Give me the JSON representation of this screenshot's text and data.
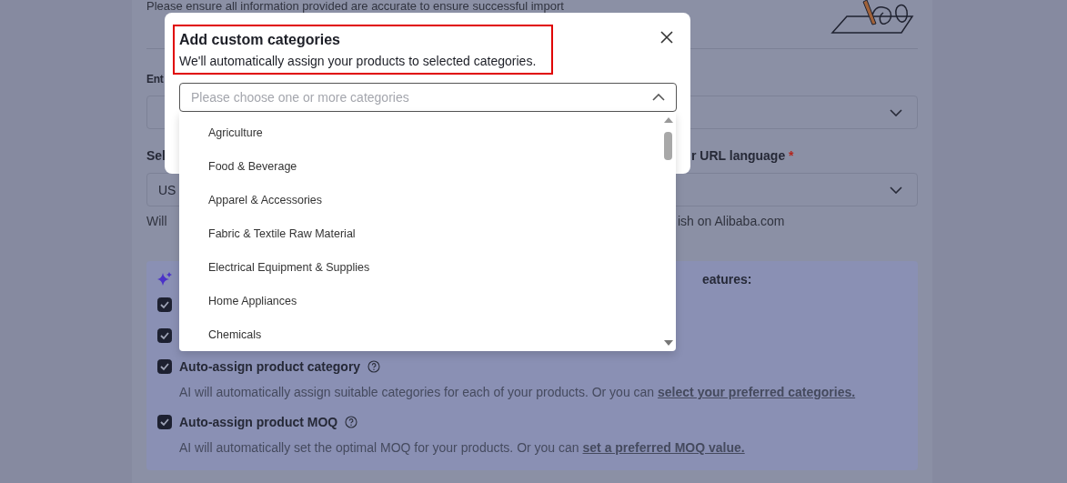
{
  "page": {
    "notice": "Please ensure all information provided are accurate to ensure successful import",
    "field_1": {
      "label": "Ent"
    },
    "field_2": {
      "label": "Sel",
      "value": "US"
    },
    "field_3": {
      "label": "r URL language",
      "required": "*"
    },
    "helper": {
      "left": "Will",
      "right": "ish on Alibaba.com"
    }
  },
  "ai_features": {
    "heading": "eatures:",
    "options": [
      {
        "checked": true
      },
      {
        "checked": true
      },
      {
        "checked": true,
        "label": "Auto-assign product category",
        "description": "AI will automatically assign suitable categories for each of your products. Or you can",
        "link": "select your preferred categories."
      },
      {
        "checked": true,
        "label": "Auto-assign product MOQ",
        "description": "AI will automatically set the optimal MOQ for your products. Or you can",
        "link": "set a preferred MOQ value."
      }
    ]
  },
  "modal": {
    "title": "Add custom categories",
    "subtitle": "We'll automatically assign your products to selected categories.",
    "highlighted": true,
    "select": {
      "placeholder": "Please choose one or more categories",
      "expanded": true
    },
    "options": [
      "Agriculture",
      "Food & Beverage",
      "Apparel & Accessories",
      "Fabric & Textile Raw Material",
      "Electrical Equipment & Supplies",
      "Home Appliances",
      "Chemicals"
    ]
  }
}
